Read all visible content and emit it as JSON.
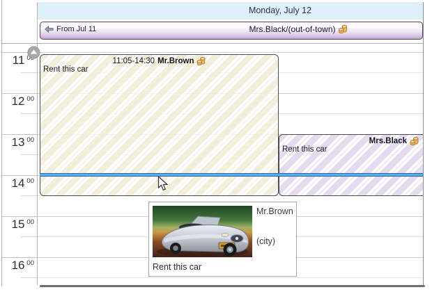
{
  "day_header": {
    "caption": "Monday, July 12"
  },
  "all_day_bar": {
    "continuation_label": "From Jul 11",
    "continuation_icon": "arrow-left-icon",
    "title": "Mrs.Black/(out-of-town)",
    "status_icon": "coins-icon"
  },
  "time_ruler": {
    "minutes_suffix": "00",
    "hours": [
      "11",
      "12",
      "13",
      "14",
      "15",
      "16"
    ]
  },
  "appointments": {
    "brown": {
      "time_range": "11:05-14:30",
      "subject": "Mr.Brown",
      "body": "Rent this car",
      "status_icon": "coins-icon",
      "fill_color": "#f2edd6"
    },
    "black": {
      "subject": "Mrs.Black",
      "body": "Rent this car",
      "status_icon": "coins-icon",
      "fill_color": "#e2d8ee"
    }
  },
  "tooltip": {
    "owner": "Mr.Brown",
    "location": "(city)",
    "body": "Rent this car",
    "image": "car-photo"
  },
  "indicators": {
    "scroll_up_icon": "chevron-up-icon",
    "current_time_color": "#2e7fd0"
  },
  "colors": {
    "day_header_bg": "#ddeff9",
    "all_day_gradient_bottom": "#bfa2d1",
    "gridline": "#d8d8d8",
    "appointment_border": "#4c4c54"
  }
}
